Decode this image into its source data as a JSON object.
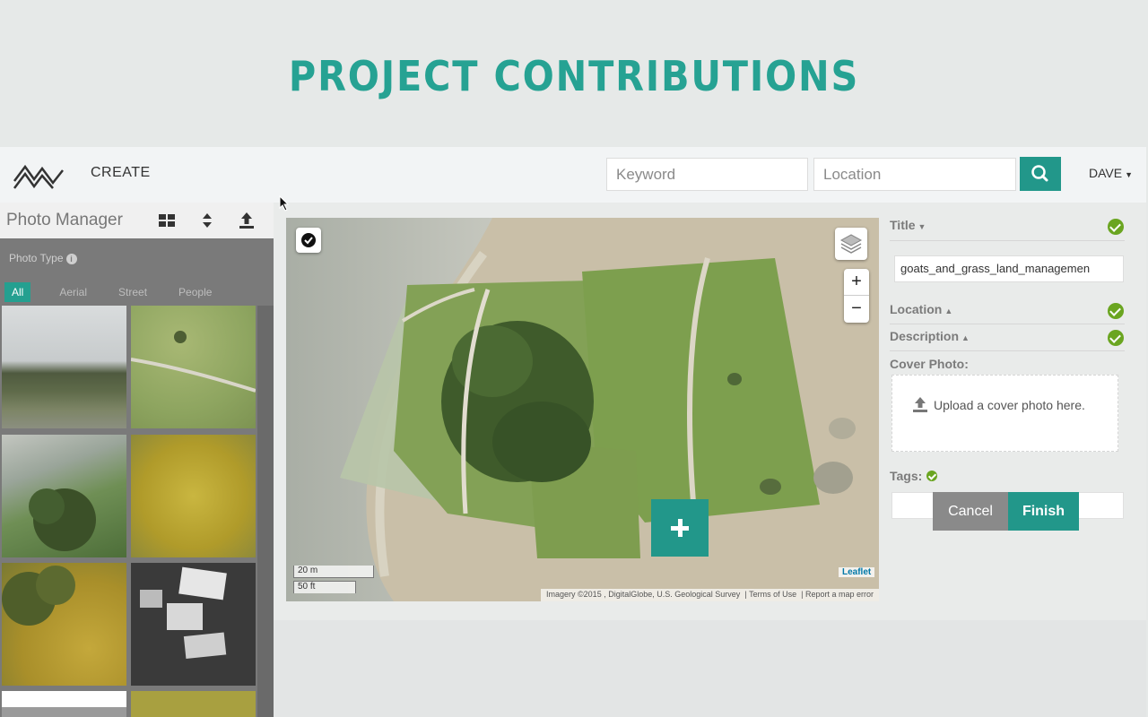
{
  "headline": "PROJECT CONTRIBUTIONS",
  "nav": {
    "create_label": "CREATE",
    "keyword_placeholder": "Keyword",
    "location_placeholder": "Location",
    "user_label": "DAVE"
  },
  "photo_manager": {
    "title": "Photo Manager",
    "photo_type_label": "Photo Type",
    "filters": [
      "All",
      "Aerial",
      "Street",
      "People"
    ],
    "active_filter": "All"
  },
  "map": {
    "scale_metric": "20 m",
    "scale_imperial": "50 ft",
    "leaflet_label": "Leaflet",
    "attribution": "Imagery ©2015 , DigitalGlobe, U.S. Geological Survey",
    "terms": "Terms of Use",
    "report": "Report a map error",
    "zoom_in": "+",
    "zoom_out": "−"
  },
  "form": {
    "title_label": "Title",
    "title_value": "goats_and_grass_land_managemen",
    "location_label": "Location",
    "description_label": "Description",
    "cover_photo_label": "Cover Photo:",
    "upload_text": "Upload a cover photo here.",
    "tags_label": "Tags:"
  },
  "actions": {
    "cancel": "Cancel",
    "finish": "Finish"
  },
  "colors": {
    "accent": "#22978a",
    "check": "#6aa520"
  }
}
